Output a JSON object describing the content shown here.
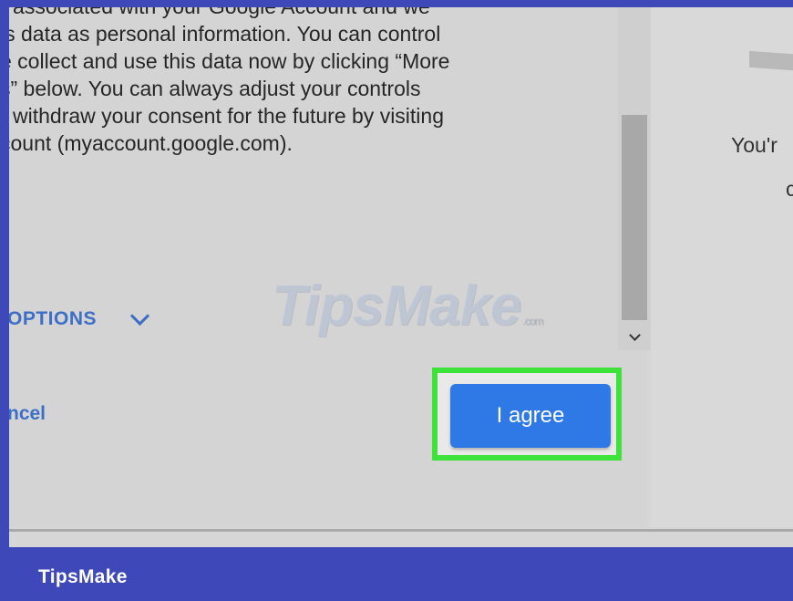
{
  "consent": {
    "lines": [
      "r associated with your Google Account and we",
      "is data as personal information. You can control",
      "e collect and use this data now by clicking “More",
      "s” below. You can always adjust your controls",
      "withdraw your consent for the future by visiting",
      "count (myaccount.google.com)."
    ]
  },
  "actions": {
    "more_options_label": "OPTIONS",
    "cancel_label": "ncel",
    "agree_label": "I agree"
  },
  "side_panel": {
    "text_1": "You'r",
    "text_2": "c"
  },
  "watermark": {
    "text": "TipsMake",
    "suffix": ".com"
  },
  "footer": {
    "label": "TipsMake"
  },
  "colors": {
    "frame": "#3f48b8",
    "accent_link": "#3d6fc6",
    "agree_button": "#2f79e6",
    "highlight": "#3fe23a"
  },
  "icons": {
    "more_options": "chevron-down-icon",
    "scroll_down": "scroll-down-arrow-icon"
  }
}
